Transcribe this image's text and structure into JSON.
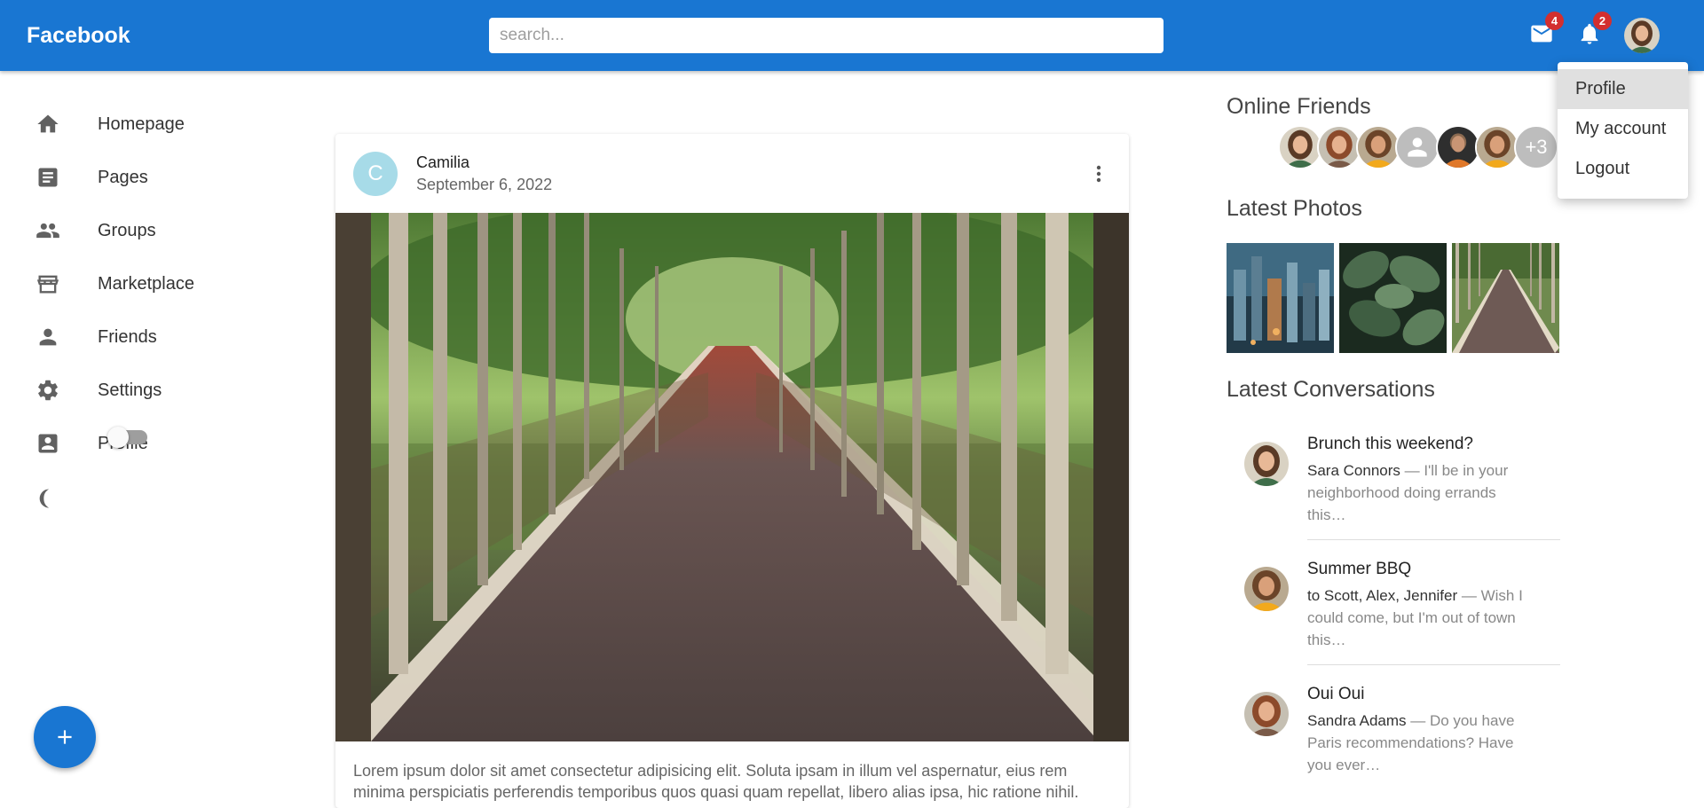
{
  "header": {
    "brand": "Facebook",
    "search_placeholder": "search...",
    "mail_badge": "4",
    "notifications_badge": "2"
  },
  "sidebar": {
    "items": [
      {
        "label": "Homepage",
        "icon": "home-icon"
      },
      {
        "label": "Pages",
        "icon": "article-icon"
      },
      {
        "label": "Groups",
        "icon": "groups-icon"
      },
      {
        "label": "Marketplace",
        "icon": "storefront-icon"
      },
      {
        "label": "Friends",
        "icon": "person-icon"
      },
      {
        "label": "Settings",
        "icon": "gear-icon"
      },
      {
        "label": "Profile",
        "icon": "account-box-icon"
      }
    ],
    "dark_mode_icon": "moon-icon",
    "dark_mode_enabled": false,
    "fab_icon": "plus-icon"
  },
  "post": {
    "avatar_letter": "C",
    "author": "Camilia",
    "date": "September 6, 2022",
    "text": "Lorem ipsum dolor sit amet consectetur adipisicing elit. Soluta ipsam in illum vel aspernatur, eius rem minima perspiciatis perferendis temporibus quos quasi quam repellat, libero alias ipsa, hic ratione nihil."
  },
  "right": {
    "online_friends_title": "Online Friends",
    "online_friends_more": "+3",
    "latest_photos_title": "Latest Photos",
    "latest_conversations_title": "Latest Conversations",
    "conversations": [
      {
        "title": "Brunch this weekend?",
        "who": "Sara Connors",
        "snippet": " — I'll be in your neighborhood doing errands this…"
      },
      {
        "title": "Summer BBQ",
        "who": "to Scott, Alex, Jennifer",
        "snippet": " — Wish I could come, but I'm out of town this…"
      },
      {
        "title": "Oui Oui",
        "who": "Sandra Adams",
        "snippet": " — Do you have Paris recommendations? Have you ever…"
      }
    ]
  },
  "account_menu": {
    "items": [
      "Profile",
      "My account",
      "Logout"
    ]
  },
  "colors": {
    "primary": "#1976d2",
    "badge": "#d32f2f"
  }
}
